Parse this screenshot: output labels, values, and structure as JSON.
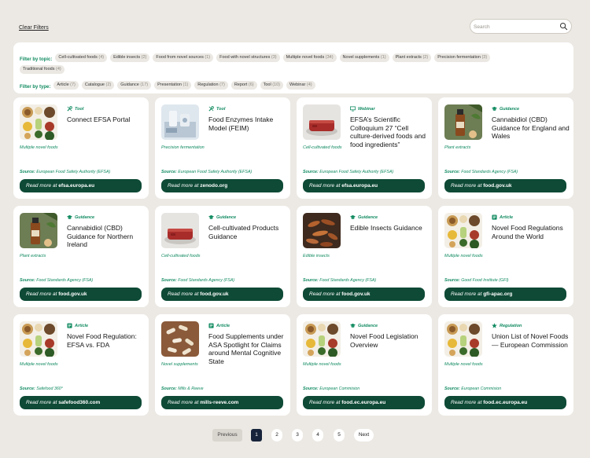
{
  "top": {
    "clear_filters": "Clear Filters",
    "search_placeholder": "Search"
  },
  "filters": {
    "topic_label": "Filter by topic:",
    "topics": [
      {
        "name": "Cell-cultivated foods",
        "count": "(4)"
      },
      {
        "name": "Edible insects",
        "count": "(2)"
      },
      {
        "name": "Food from novel sources",
        "count": "(1)"
      },
      {
        "name": "Food with novel structures",
        "count": "(3)"
      },
      {
        "name": "Multiple novel foods",
        "count": "(34)"
      },
      {
        "name": "Novel supplements",
        "count": "(1)"
      },
      {
        "name": "Plant extracts",
        "count": "(2)"
      },
      {
        "name": "Precision fermentation",
        "count": "(3)"
      },
      {
        "name": "Traditional foods",
        "count": "(4)"
      }
    ],
    "type_label": "Filter by type:",
    "types": [
      {
        "name": "Article",
        "count": "(7)"
      },
      {
        "name": "Catalogue",
        "count": "(2)"
      },
      {
        "name": "Guidance",
        "count": "(17)"
      },
      {
        "name": "Presentation",
        "count": "(1)"
      },
      {
        "name": "Regulation",
        "count": "(7)"
      },
      {
        "name": "Report",
        "count": "(6)"
      },
      {
        "name": "Tool",
        "count": "(10)"
      },
      {
        "name": "Webinar",
        "count": "(4)"
      }
    ]
  },
  "cards": [
    {
      "type": "Tool",
      "type_icon": "tool-icon",
      "title": "Connect EFSA Portal",
      "topic": "Multiple novel foods",
      "source_label": "Source:",
      "source": "European Food Safety Authority (EFSA)",
      "read_label": "Read more at",
      "domain": "efsa.europa.eu",
      "image": "food-mix"
    },
    {
      "type": "Tool",
      "type_icon": "tool-icon",
      "title": "Food Enzymes Intake Model (FEIM)",
      "topic": "Precision fermentation",
      "source_label": "Source:",
      "source": "European Food Safety Authority (EFSA)",
      "read_label": "Read more at",
      "domain": "zenodo.org",
      "image": "lab"
    },
    {
      "type": "Webinar",
      "type_icon": "monitor-icon",
      "title": "EFSA’s Scientific Colloquium 27 “Cell culture-derived foods and food ingredients”",
      "topic": "Cell-cultivated foods",
      "source_label": "Source:",
      "source": "European Food Safety Authority (EFSA)",
      "read_label": "Read more at",
      "domain": "efsa.europa.eu",
      "image": "meat"
    },
    {
      "type": "Guidance",
      "type_icon": "cap-icon",
      "title": "Cannabidiol (CBD) Guidance for England and Wales",
      "topic": "Plant extracts",
      "source_label": "Source:",
      "source": "Food Standards Agency (FSA)",
      "read_label": "Read more at",
      "domain": "food.gov.uk",
      "image": "cbd"
    },
    {
      "type": "Guidance",
      "type_icon": "cap-icon",
      "title": "Cannabidiol (CBD) Guidance for Northern Ireland",
      "topic": "Plant extracts",
      "source_label": "Source:",
      "source": "Food Standards Agency (FSA)",
      "read_label": "Read more at",
      "domain": "food.gov.uk",
      "image": "cbd"
    },
    {
      "type": "Guidance",
      "type_icon": "cap-icon",
      "title": "Cell-cultivated Products Guidance",
      "topic": "Cell-cultivated foods",
      "source_label": "Source:",
      "source": "Food Standards Agency (FSA)",
      "read_label": "Read more at",
      "domain": "food.gov.uk",
      "image": "meat"
    },
    {
      "type": "Guidance",
      "type_icon": "cap-icon",
      "title": "Edible Insects Guidance",
      "topic": "Edible insects",
      "source_label": "Source:",
      "source": "Food Standards Agency (FSA)",
      "read_label": "Read more at",
      "domain": "food.gov.uk",
      "image": "insects"
    },
    {
      "type": "Article",
      "type_icon": "article-icon",
      "title": "Novel Food Regulations Around the World",
      "topic": "Multiple novel foods",
      "source_label": "Source:",
      "source": "Good Food Institute (GFI)",
      "read_label": "Read more at",
      "domain": "gfi-apac.org",
      "image": "food-mix"
    },
    {
      "type": "Article",
      "type_icon": "article-icon",
      "title": "Novel Food Regulation: EFSA vs. FDA",
      "topic": "Multiple novel foods",
      "source_label": "Source:",
      "source": "Safefood 360°",
      "read_label": "Read more at",
      "domain": "safefood360.com",
      "image": "food-mix"
    },
    {
      "type": "Article",
      "type_icon": "article-icon",
      "title": "Food Supplements under ASA Spotlight for Claims around Mental Cognitive State",
      "topic": "Novel supplements",
      "source_label": "Source:",
      "source": "Mills & Reeve",
      "read_label": "Read more at",
      "domain": "mills-reeve.com",
      "image": "pills"
    },
    {
      "type": "Guidance",
      "type_icon": "cap-icon",
      "title": "Novel Food Legislation Overview",
      "topic": "Multiple novel foods",
      "source_label": "Source:",
      "source": "European Commision",
      "read_label": "Read more at",
      "domain": "food.ec.europa.eu",
      "image": "food-mix"
    },
    {
      "type": "Regulation",
      "type_icon": "star-icon",
      "title": "Union List of Novel Foods — European Commission",
      "topic": "Multiple novel foods",
      "source_label": "Source:",
      "source": "European Commision",
      "read_label": "Read more at",
      "domain": "food.ec.europa.eu",
      "image": "food-mix"
    }
  ],
  "pagination": {
    "previous": "Previous",
    "pages": [
      "1",
      "2",
      "3",
      "4",
      "5"
    ],
    "current": "1",
    "next": "Next"
  },
  "colors": {
    "accent_green": "#0f8a5f",
    "button_dark_green": "#0e4a36",
    "active_page": "#17233a",
    "background": "#ece9e4"
  }
}
